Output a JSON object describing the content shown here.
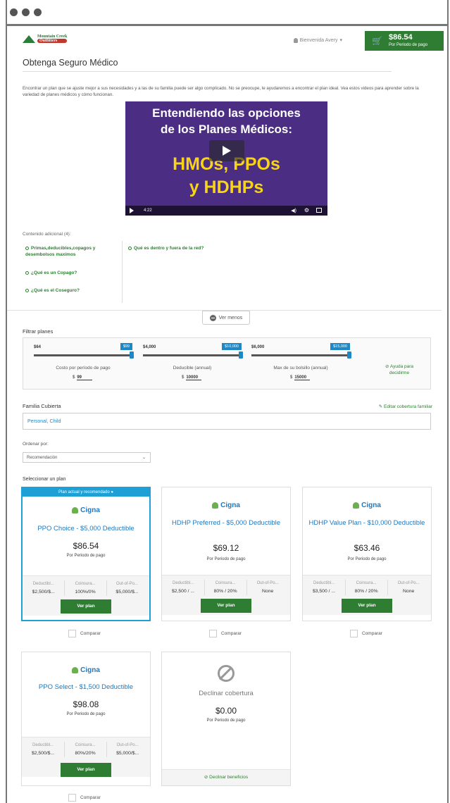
{
  "header": {
    "logo_top": "Mountain Creek",
    "logo_bottom": "Outfitters",
    "user_name": "Bienvenida Avery",
    "user_caret": "▾",
    "cart_amount": "$86.54",
    "cart_period": "Por Periodo de pago"
  },
  "page": {
    "title": "Obtenga Seguro Médico",
    "intro": "Encontrar un plan que se ajuste mejor a sus necesidades y a las de su familia puede ser algo complicado. No se preocupe, le ayudaremos a encontrar el plan ideal. Vea estos videos para aprender sobre la variedad de planes médicos y cómo funcionan."
  },
  "video": {
    "line1": "Entendiendo las opciones",
    "line2": "de los Planes Médicos:",
    "big1": "HMOs, PPOs",
    "big2": "y HDHPs",
    "time": "4:22"
  },
  "extra": {
    "label": "Contenido adicional (4):",
    "links": [
      "Primas,deducibles,copagos y desembolsos maximos",
      "¿Qué es un Copago?",
      "¿Qué es el Coseguro?",
      "Qué es dentro y fuera de la red?"
    ],
    "see_less": "Ver menos"
  },
  "filters": {
    "label": "Filtrar planes",
    "sliders": [
      {
        "min": "$64",
        "max": "$99",
        "caption": "Costo por período de pago",
        "value": "99"
      },
      {
        "min": "$4,000",
        "max": "$10,000",
        "caption": "Deducible (annual)",
        "value": "10000"
      },
      {
        "min": "$6,000",
        "max": "$15,000",
        "caption": "Max de su bolsillo (annual)",
        "value": "15000"
      }
    ],
    "currency": "$",
    "help": "Ayuda para decidirme"
  },
  "family": {
    "label": "Familia Cubierta",
    "edit": "Editar cobertura familiar",
    "value": "Personal, Child"
  },
  "sort": {
    "label": "Ordenar por:",
    "value": "Recomendación"
  },
  "plans_label": "Seleccionar un plan",
  "current_banner": "Plan actual y recomendado",
  "brand": "Cigna",
  "stat_labels": [
    "Deductibl...",
    "Coinsura...",
    "Out-of-Po..."
  ],
  "view_plan": "Ver plan",
  "compare": "Comparar",
  "period": "Por Periodo de pago",
  "plans": [
    {
      "name": "PPO Choice - $5,000 Deductible",
      "price": "$86.54",
      "stats": [
        "$2,500/$...",
        "100%/0%",
        "$5,000/$..."
      ]
    },
    {
      "name": "HDHP Preferred - $5,000 Deductible",
      "price": "$69.12",
      "stats": [
        "$2,500 / ...",
        "80% / 20%",
        "None"
      ]
    },
    {
      "name": "HDHP Value Plan - $10,000 Deductible",
      "price": "$63.46",
      "stats": [
        "$3,500 / ...",
        "80% / 20%",
        "None"
      ]
    },
    {
      "name": "PPO Select - $1,500 Deductible",
      "price": "$98.08",
      "stats": [
        "$2,500/$...",
        "80%/20%",
        "$5,000/$..."
      ]
    }
  ],
  "decline": {
    "title": "Declinar cobertura",
    "price": "$0.00",
    "footer": "Declinar beneficios"
  },
  "colors": {
    "accent_green": "#2e7d32",
    "accent_blue": "#1e9fd6",
    "video_purple": "#4b2e83",
    "video_yellow": "#f7d417"
  }
}
